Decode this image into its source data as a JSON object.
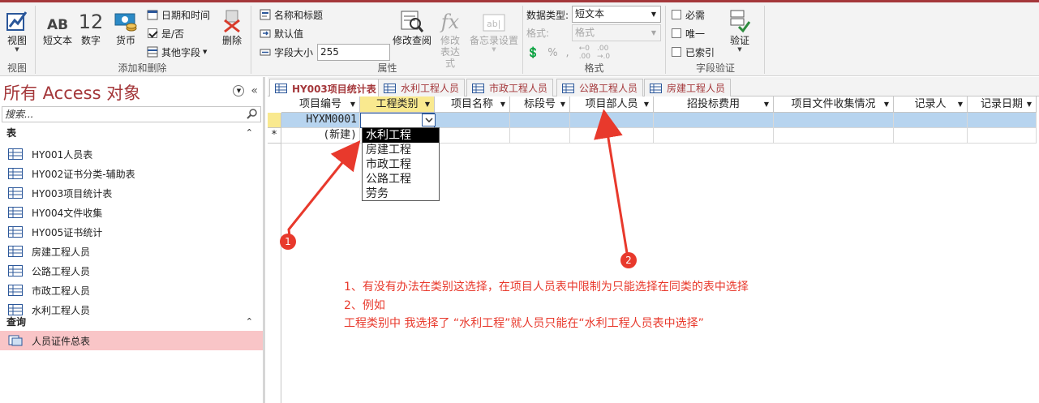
{
  "ribbon": {
    "view_group": {
      "label": "视图",
      "view_button": "视图"
    },
    "add_delete_group": {
      "label": "添加和删除",
      "short_text": "短文本",
      "short_text_icon": "AB",
      "number": "数字",
      "number_icon": "12",
      "currency": "货币",
      "date_time": "日期和时间",
      "yes_no": "是/否",
      "more_fields": "其他字段",
      "delete": "删除"
    },
    "properties_group": {
      "label": "属性",
      "name_caption": "名称和标题",
      "default_value": "默认值",
      "field_size_label": "字段大小",
      "field_size_value": "255",
      "modify_lookups": "修改查阅",
      "modify_expression": "修改表达式",
      "memo_settings": "备忘录设置"
    },
    "format_group": {
      "label": "格式",
      "data_type_label": "数据类型:",
      "data_type_value": "短文本",
      "format_label": "格式:",
      "format_value": "格式"
    },
    "validation_group": {
      "label": "字段验证",
      "required": "必需",
      "unique": "唯一",
      "indexed": "已索引",
      "validation": "验证"
    }
  },
  "nav": {
    "title": "所有 Access 对象",
    "search_placeholder": "搜索...",
    "tables_section": "表",
    "tables": [
      "HY001人员表",
      "HY002证书分类-辅助表",
      "HY003项目统计表",
      "HY004文件收集",
      "HY005证书统计",
      "房建工程人员",
      "公路工程人员",
      "市政工程人员",
      "水利工程人员"
    ],
    "queries_section": "查询",
    "queries": [
      "人员证件总表"
    ]
  },
  "tabs": [
    "HY003项目统计表",
    "水利工程人员",
    "市政工程人员",
    "公路工程人员",
    "房建工程人员"
  ],
  "grid": {
    "columns": [
      "项目编号",
      "工程类别",
      "项目名称",
      "标段号",
      "项目部人员",
      "招投标费用",
      "项目文件收集情况",
      "记录人",
      "记录日期"
    ],
    "row1": [
      "HYXM0001"
    ],
    "new_row": "(新建)",
    "new_row_marker": "*"
  },
  "dropdown_options": [
    "水利工程",
    "房建工程",
    "市政工程",
    "公路工程",
    "劳务"
  ],
  "annotations": {
    "line1": "1、有没有办法在类别这选择，在项目人员表中限制为只能选择在同类的表中选择",
    "line2": "2、例如",
    "line3": "工程类别中 我选择了 “水利工程”就人员只能在“水利工程人员表中选择”",
    "badge1": "1",
    "badge2": "2"
  },
  "colors": {
    "accent": "#a4373a",
    "annotation": "#e8392c",
    "selected_row": "#b7d4ef",
    "header_highlight": "#f9e98f"
  }
}
